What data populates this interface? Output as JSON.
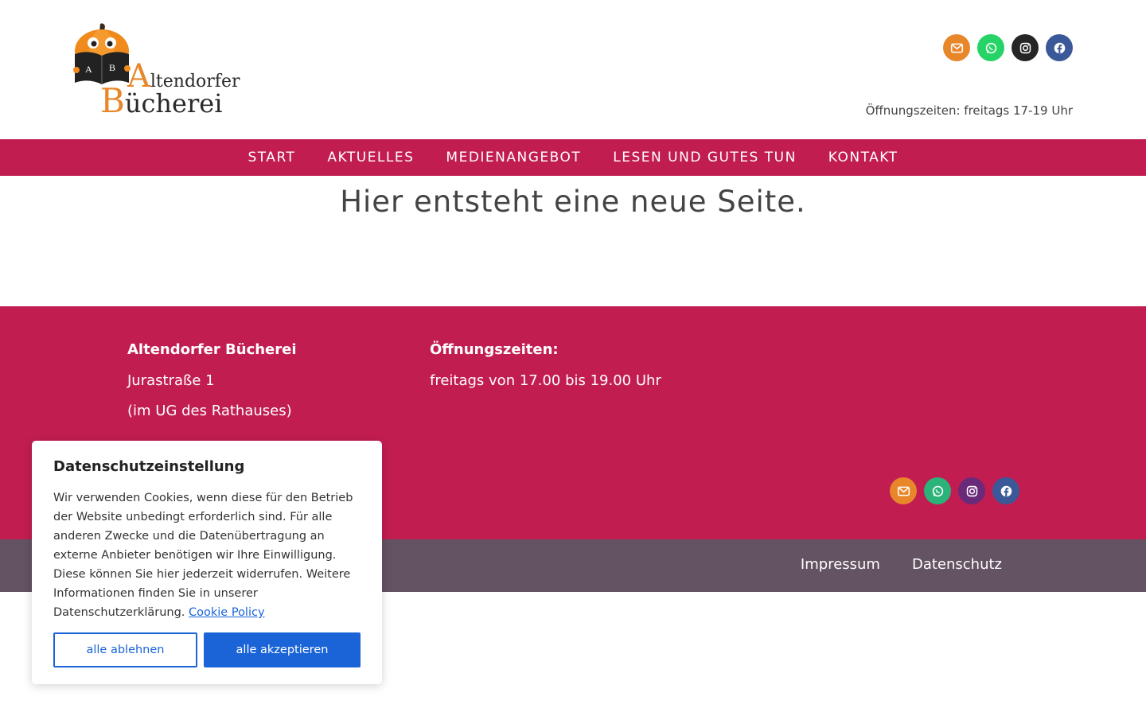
{
  "header": {
    "logo": {
      "lines": [
        "Altendorfer",
        "Bücherei"
      ],
      "book_letters": [
        "A",
        "B"
      ]
    },
    "social": [
      {
        "icon": "email-icon",
        "color": "#e8862a"
      },
      {
        "icon": "whatsapp-icon",
        "color": "#25d366"
      },
      {
        "icon": "instagram-icon",
        "color": "#262626"
      },
      {
        "icon": "facebook-icon",
        "color": "#3b5998"
      }
    ],
    "hours": "Öffnungszeiten: freitags 17-19 Uhr"
  },
  "nav": {
    "items": [
      "START",
      "AKTUELLES",
      "MEDIENANGEBOT",
      "LESEN UND GUTES TUN",
      "KONTAKT"
    ],
    "color": "#c21d51"
  },
  "main": {
    "title": "Hier entsteht eine neue Seite."
  },
  "footer": {
    "color": "#c21d51",
    "col1": {
      "heading": "Altendorfer Bücherei",
      "lines": [
        "Jurastraße 1",
        "(im UG des Rathauses)"
      ]
    },
    "col2": {
      "heading": "Öffnungszeiten:",
      "lines": [
        "freitags von 17.00 bis 19.00 Uhr"
      ]
    },
    "social": [
      {
        "icon": "email-icon",
        "color": "#e8862a"
      },
      {
        "icon": "whatsapp-icon",
        "color": "#2bb37a"
      },
      {
        "icon": "instagram-icon",
        "color": "#6a2a7a"
      },
      {
        "icon": "facebook-icon",
        "color": "#3b5998"
      }
    ]
  },
  "bottom_bar": {
    "color": "#635363",
    "links": [
      "Impressum",
      "Datenschutz"
    ]
  },
  "cookie": {
    "title": "Datenschutzeinstellung",
    "text": "Wir verwenden Cookies, wenn diese für den Betrieb der Website unbedingt erforderlich sind. Für alle anderen Zwecke und die Datenübertragung an externe Anbieter benötigen wir Ihre Einwilligung. Diese können Sie hier jederzeit widerrufen. Weitere Informationen finden Sie in unserer Datenschutzerklärung.",
    "link": "Cookie Policy",
    "deny_label": "alle ablehnen",
    "accept_label": "alle akzeptieren",
    "accent": "#1a64d8"
  }
}
